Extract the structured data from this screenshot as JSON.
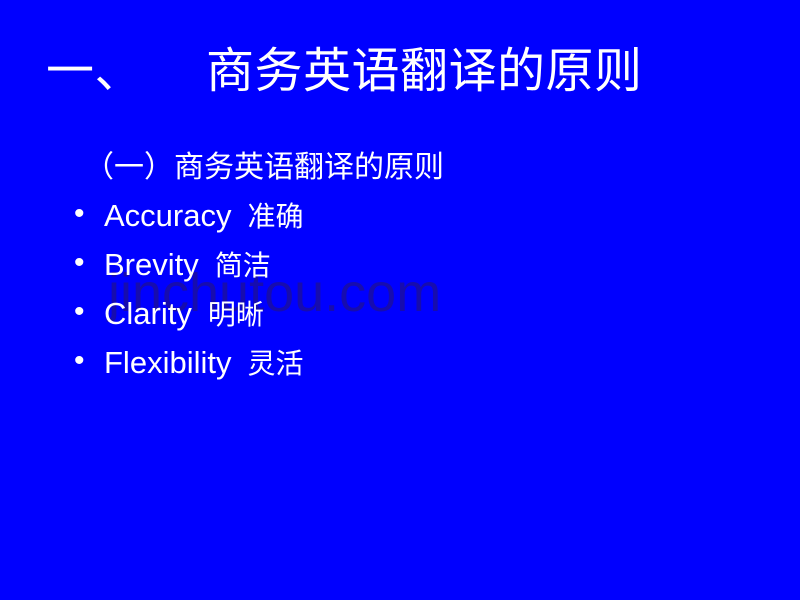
{
  "slide": {
    "background_color": "#0000ff",
    "text_color": "#ffffff",
    "title": "一、    商务英语翻译的原则",
    "subtitle": "（一）商务英语翻译的原则",
    "bullet_marker": "•",
    "bullets": [
      {
        "english": "Accuracy",
        "chinese": "准确"
      },
      {
        "english": "Brevity",
        "chinese": "简洁"
      },
      {
        "english": "Clarity",
        "chinese": "明晰"
      },
      {
        "english": "Flexibility",
        "chinese": "灵活"
      }
    ]
  },
  "watermark": {
    "text": "jinchutou.com",
    "color": "#1c0fa0"
  }
}
